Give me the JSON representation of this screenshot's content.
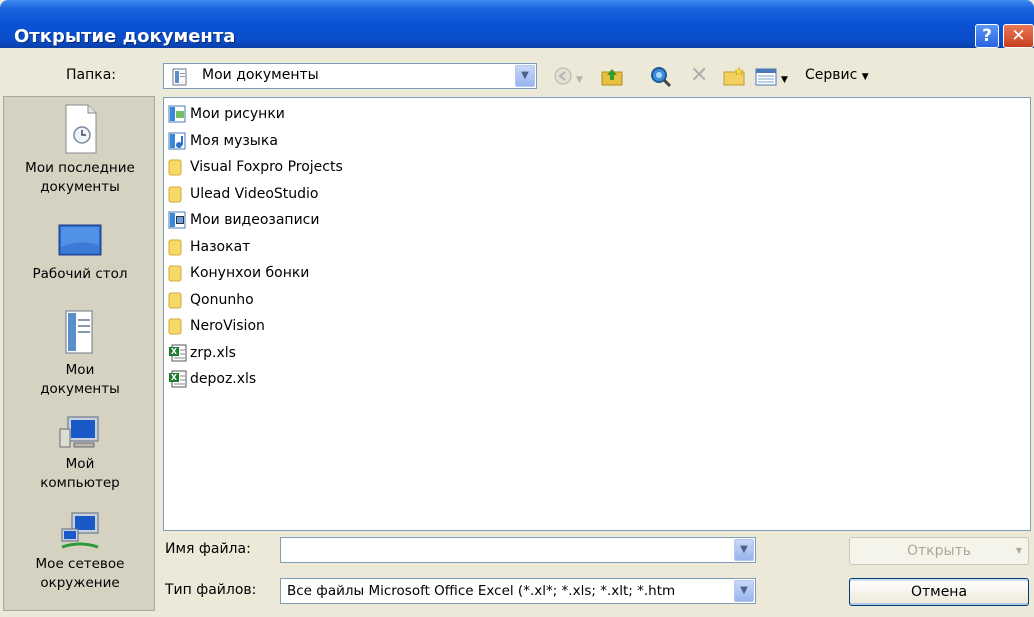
{
  "window": {
    "title": "Открытие документа",
    "help_glyph": "?",
    "close_glyph": "✕"
  },
  "folder_bar": {
    "label": "Папка:",
    "current_folder": "Мои документы",
    "tools_label": "Сервис"
  },
  "places": [
    {
      "label": "Мои последние документы",
      "icon": "recent-documents-icon"
    },
    {
      "label": "Рабочий стол",
      "icon": "desktop-icon"
    },
    {
      "label": "Мои документы",
      "icon": "my-documents-icon"
    },
    {
      "label": "Мой компьютер",
      "icon": "my-computer-icon"
    },
    {
      "label": "Мое сетевое окружение",
      "icon": "network-places-icon"
    }
  ],
  "files": [
    {
      "name": "Мои рисунки",
      "icon": "pictures-folder-icon"
    },
    {
      "name": "Моя музыка",
      "icon": "music-folder-icon"
    },
    {
      "name": "Visual Foxpro Projects",
      "icon": "folder-icon"
    },
    {
      "name": "Ulead VideoStudio",
      "icon": "folder-icon"
    },
    {
      "name": "Мои видеозаписи",
      "icon": "video-folder-icon"
    },
    {
      "name": "Назокат",
      "icon": "folder-icon"
    },
    {
      "name": "Конунхои бонки",
      "icon": "folder-icon"
    },
    {
      "name": "Qonunho",
      "icon": "folder-icon"
    },
    {
      "name": "NeroVision",
      "icon": "folder-icon"
    },
    {
      "name": "zrp.xls",
      "icon": "excel-file-icon"
    },
    {
      "name": "depoz.xls",
      "icon": "excel-file-icon"
    }
  ],
  "filename": {
    "label": "Имя файла:",
    "value": ""
  },
  "filetype": {
    "label": "Тип файлов:",
    "value": "Все файлы Microsoft Office Excel (*.xl*; *.xls; *.xlt; *.htm"
  },
  "buttons": {
    "open": "Открыть",
    "cancel": "Отмена"
  },
  "colors": {
    "titlebar": "#0a52d6",
    "dialog_bg": "#ece9d8",
    "places_bg": "#d6d2c2"
  }
}
